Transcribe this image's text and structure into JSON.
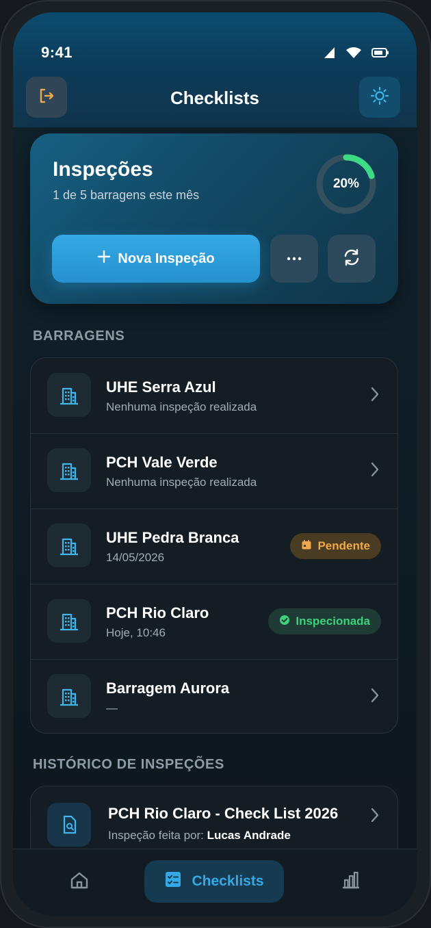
{
  "status": {
    "time": "9:41"
  },
  "header": {
    "title": "Checklists",
    "left_icon": "logout-icon",
    "right_icon": "sun-icon"
  },
  "summary": {
    "title": "Inspeções",
    "subtitle": "1 de 5 barragens este mês",
    "progress_percent": 20,
    "progress_label": "20%",
    "new_button": "Nova Inspeção",
    "colors": {
      "progress": "#3ddc84",
      "accent": "#2f9fdd"
    }
  },
  "sections": {
    "dams": "BARRAGENS",
    "history": "HISTÓRICO DE INSPEÇÕES"
  },
  "dams": [
    {
      "name": "UHE Serra Azul",
      "detail": "Nenhuma inspeção realizada",
      "status": ""
    },
    {
      "name": "PCH Vale Verde",
      "detail": "Nenhuma inspeção realizada",
      "status": ""
    },
    {
      "name": "UHE Pedra Branca",
      "detail": "14/05/2026",
      "status": "Pendente"
    },
    {
      "name": "PCH Rio Claro",
      "detail": "Hoje, 10:46",
      "status": "Inspecionada"
    },
    {
      "name": "Barragem Aurora",
      "detail": "—",
      "status": ""
    }
  ],
  "history": [
    {
      "title": "PCH Rio Claro - Check List 2026",
      "by_label": "Inspeção feita por:",
      "by": "Lucas Andrade"
    }
  ],
  "nav": {
    "active_label": "Checklists",
    "items": [
      "home-icon",
      "checklist-icon",
      "bar-chart-icon"
    ]
  }
}
